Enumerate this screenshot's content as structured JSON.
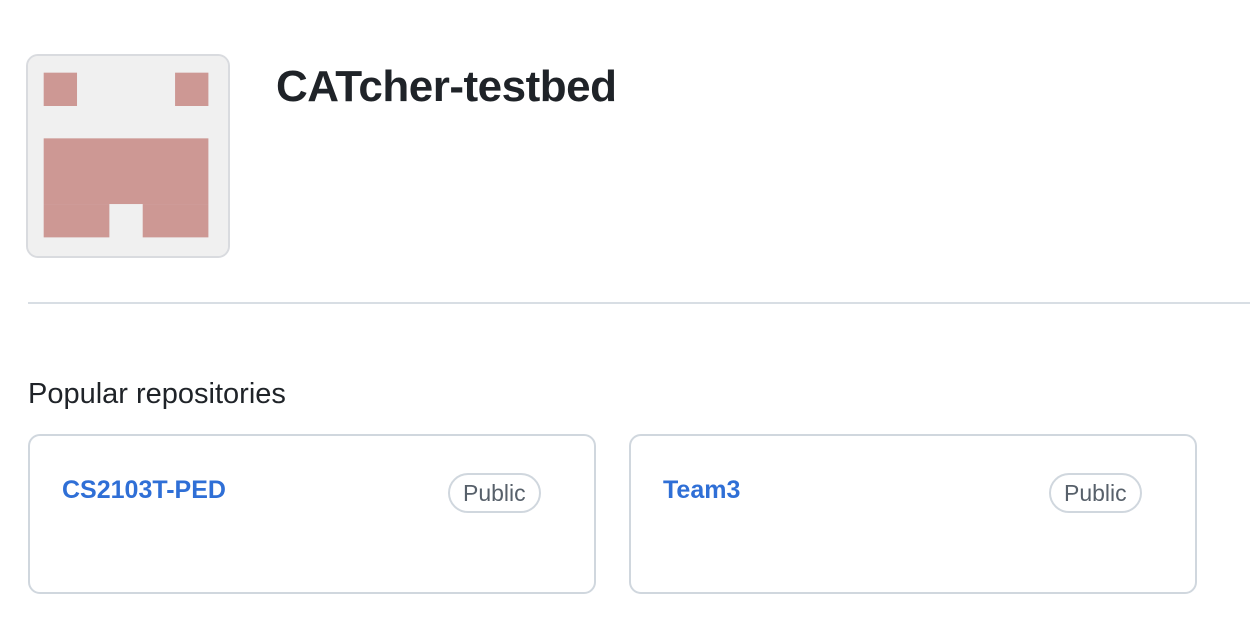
{
  "org": {
    "name": "CATcher-testbed",
    "avatar_icon": "identicon",
    "avatar_color": "#cd9894"
  },
  "popular": {
    "heading": "Popular repositories",
    "repos": [
      {
        "name": "CS2103T-PED",
        "visibility": "Public"
      },
      {
        "name": "Team3",
        "visibility": "Public"
      }
    ]
  },
  "colors": {
    "link": "#2f6fd6",
    "border": "#d0d7de",
    "text": "#1f2328",
    "muted": "#57606a"
  }
}
